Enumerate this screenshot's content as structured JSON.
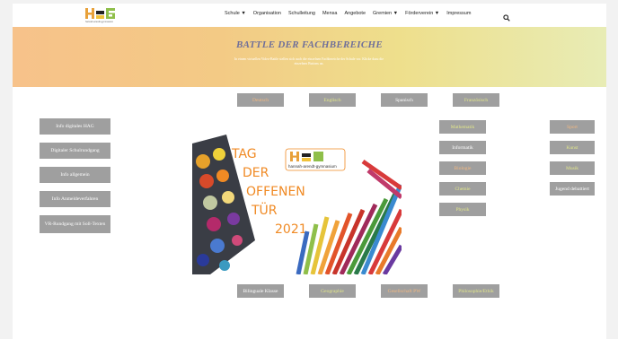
{
  "nav": {
    "items": [
      "Schule ▼",
      "Organisation",
      "Schulleitung",
      "Mensa",
      "Angebote",
      "Gremien ▼",
      "Förderverein ▼",
      "Impressum"
    ]
  },
  "logo": {
    "text": "hannah-arendt-gymnasium"
  },
  "banner": {
    "title": "BATTLE DER FACHBEREICHE",
    "text": "In einem virtuellen Video-Battle stellen sich auch die einzelnen Fachbereiche der Schule vor. Klicke dazu die einzelnen Buttons an."
  },
  "left_buttons": [
    "Info digitales HAG",
    "Digitaler Schulrundgang",
    "Info allgemein",
    "Info Anmeldeverfahren",
    "VR-Rundgang mit Soll-Texten"
  ],
  "top_buttons": [
    "Deutsch",
    "Englisch",
    "Spanisch",
    "Französisch"
  ],
  "middle_buttons": [
    "Mathematik",
    "Informatik",
    "Biologie",
    "Chemie",
    "Physik"
  ],
  "right_buttons": [
    "Sport",
    "Kunst",
    "Musik",
    "Jugend debattiert"
  ],
  "bottom_buttons": [
    "Bilinguale Klasse",
    "Geographie",
    "Gesellschaft PW",
    "Philosophie/Ethik"
  ],
  "poster": {
    "line1": "TAG",
    "line2": "DER",
    "line3": "OFFENEN",
    "line4": "TÜR",
    "line5": "2021",
    "logo_text": "hannah-arendt-gymnasium"
  },
  "colors": {
    "button_bg": "#9f9f9f",
    "orange_text": "#f4b980",
    "yellow_text": "#e3e88a",
    "poster_text": "#f08a24"
  }
}
